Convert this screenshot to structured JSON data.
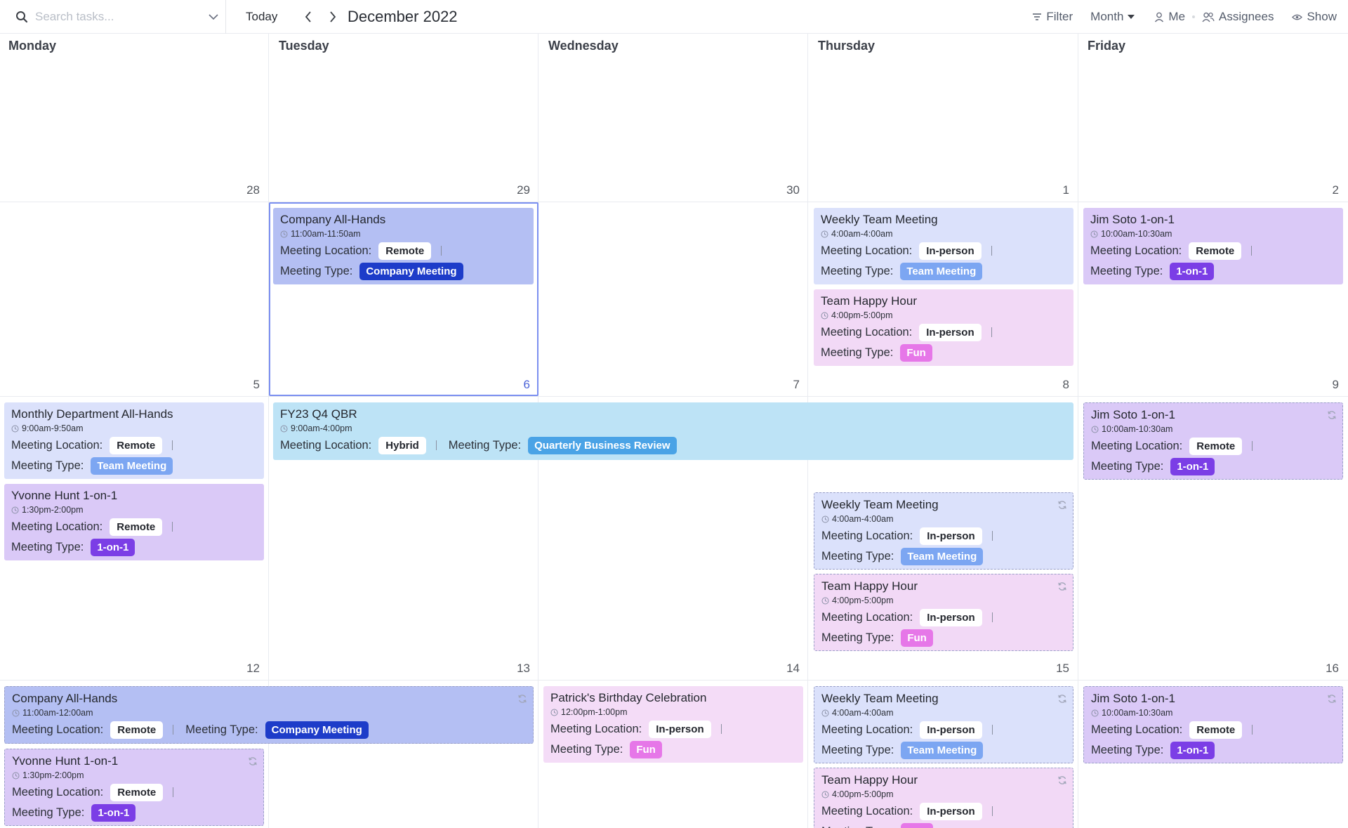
{
  "toolbar": {
    "search_placeholder": "Search tasks...",
    "today_label": "Today",
    "month_title": "December 2022",
    "filter_label": "Filter",
    "view_label": "Month",
    "me_label": "Me",
    "assignees_label": "Assignees",
    "show_label": "Show"
  },
  "labels": {
    "location": "Meeting Location:",
    "type": "Meeting Type:"
  },
  "days": [
    "Monday",
    "Tuesday",
    "Wednesday",
    "Thursday",
    "Friday"
  ],
  "weeks": [
    [
      "28",
      "29",
      "30",
      "1",
      "2"
    ],
    [
      "5",
      "6",
      "7",
      "8",
      "9"
    ],
    [
      "12",
      "13",
      "14",
      "15",
      "16"
    ]
  ],
  "colors": {
    "company_card": "#b4bff3",
    "team_card": "#dbe1fb",
    "fun_card": "#f2d9f6",
    "oneonone_card": "#dac9f7",
    "qbr_card": "#bde3f6",
    "birthday_card": "#f4dcf7",
    "tag_company": "#1d3cc9",
    "tag_team": "#7ca6f2",
    "tag_fun": "#e677e8",
    "tag_oneonone": "#7b3ee6",
    "tag_qbr": "#4aa3e6",
    "today_border": "#7b8ff0"
  },
  "events": [
    {
      "title": "Company All-Hands",
      "time": "11:00am-11:50am",
      "location": "Remote",
      "type": "Company Meeting"
    },
    {
      "title": "Weekly Team Meeting",
      "time": "4:00am-4:00am",
      "location": "In-person",
      "type": "Team Meeting"
    },
    {
      "title": "Team Happy Hour",
      "time": "4:00pm-5:00pm",
      "location": "In-person",
      "type": "Fun"
    },
    {
      "title": "Jim Soto 1-on-1",
      "time": "10:00am-10:30am",
      "location": "Remote",
      "type": "1-on-1"
    },
    {
      "title": "Monthly Department All-Hands",
      "time": "9:00am-9:50am",
      "location": "Remote",
      "type": "Team Meeting"
    },
    {
      "title": "Yvonne Hunt 1-on-1",
      "time": "1:30pm-2:00pm",
      "location": "Remote",
      "type": "1-on-1"
    },
    {
      "title": "FY23 Q4 QBR",
      "time": "9:00am-4:00pm",
      "location": "Hybrid",
      "type": "Quarterly Business Review"
    },
    {
      "title": "Jim Soto 1-on-1",
      "time": "10:00am-10:30am",
      "location": "Remote",
      "type": "1-on-1"
    },
    {
      "title": "Weekly Team Meeting",
      "time": "4:00am-4:00am",
      "location": "In-person",
      "type": "Team Meeting"
    },
    {
      "title": "Team Happy Hour",
      "time": "4:00pm-5:00pm",
      "location": "In-person",
      "type": "Fun"
    },
    {
      "title": "Company All-Hands",
      "time": "11:00am-12:00am",
      "location": "Remote",
      "type": "Company Meeting"
    },
    {
      "title": "Yvonne Hunt 1-on-1",
      "time": "1:30pm-2:00pm",
      "location": "Remote",
      "type": "1-on-1"
    },
    {
      "title": "Patrick's Birthday Celebration",
      "time": "12:00pm-1:00pm",
      "location": "In-person",
      "type": "Fun"
    },
    {
      "title": "Weekly Team Meeting",
      "time": "4:00am-4:00am",
      "location": "In-person",
      "type": "Team Meeting"
    },
    {
      "title": "Team Happy Hour",
      "time": "4:00pm-5:00pm",
      "location": "In-person",
      "type": "Fun"
    },
    {
      "title": "Jim Soto 1-on-1",
      "time": "10:00am-10:30am",
      "location": "Remote",
      "type": "1-on-1"
    }
  ]
}
